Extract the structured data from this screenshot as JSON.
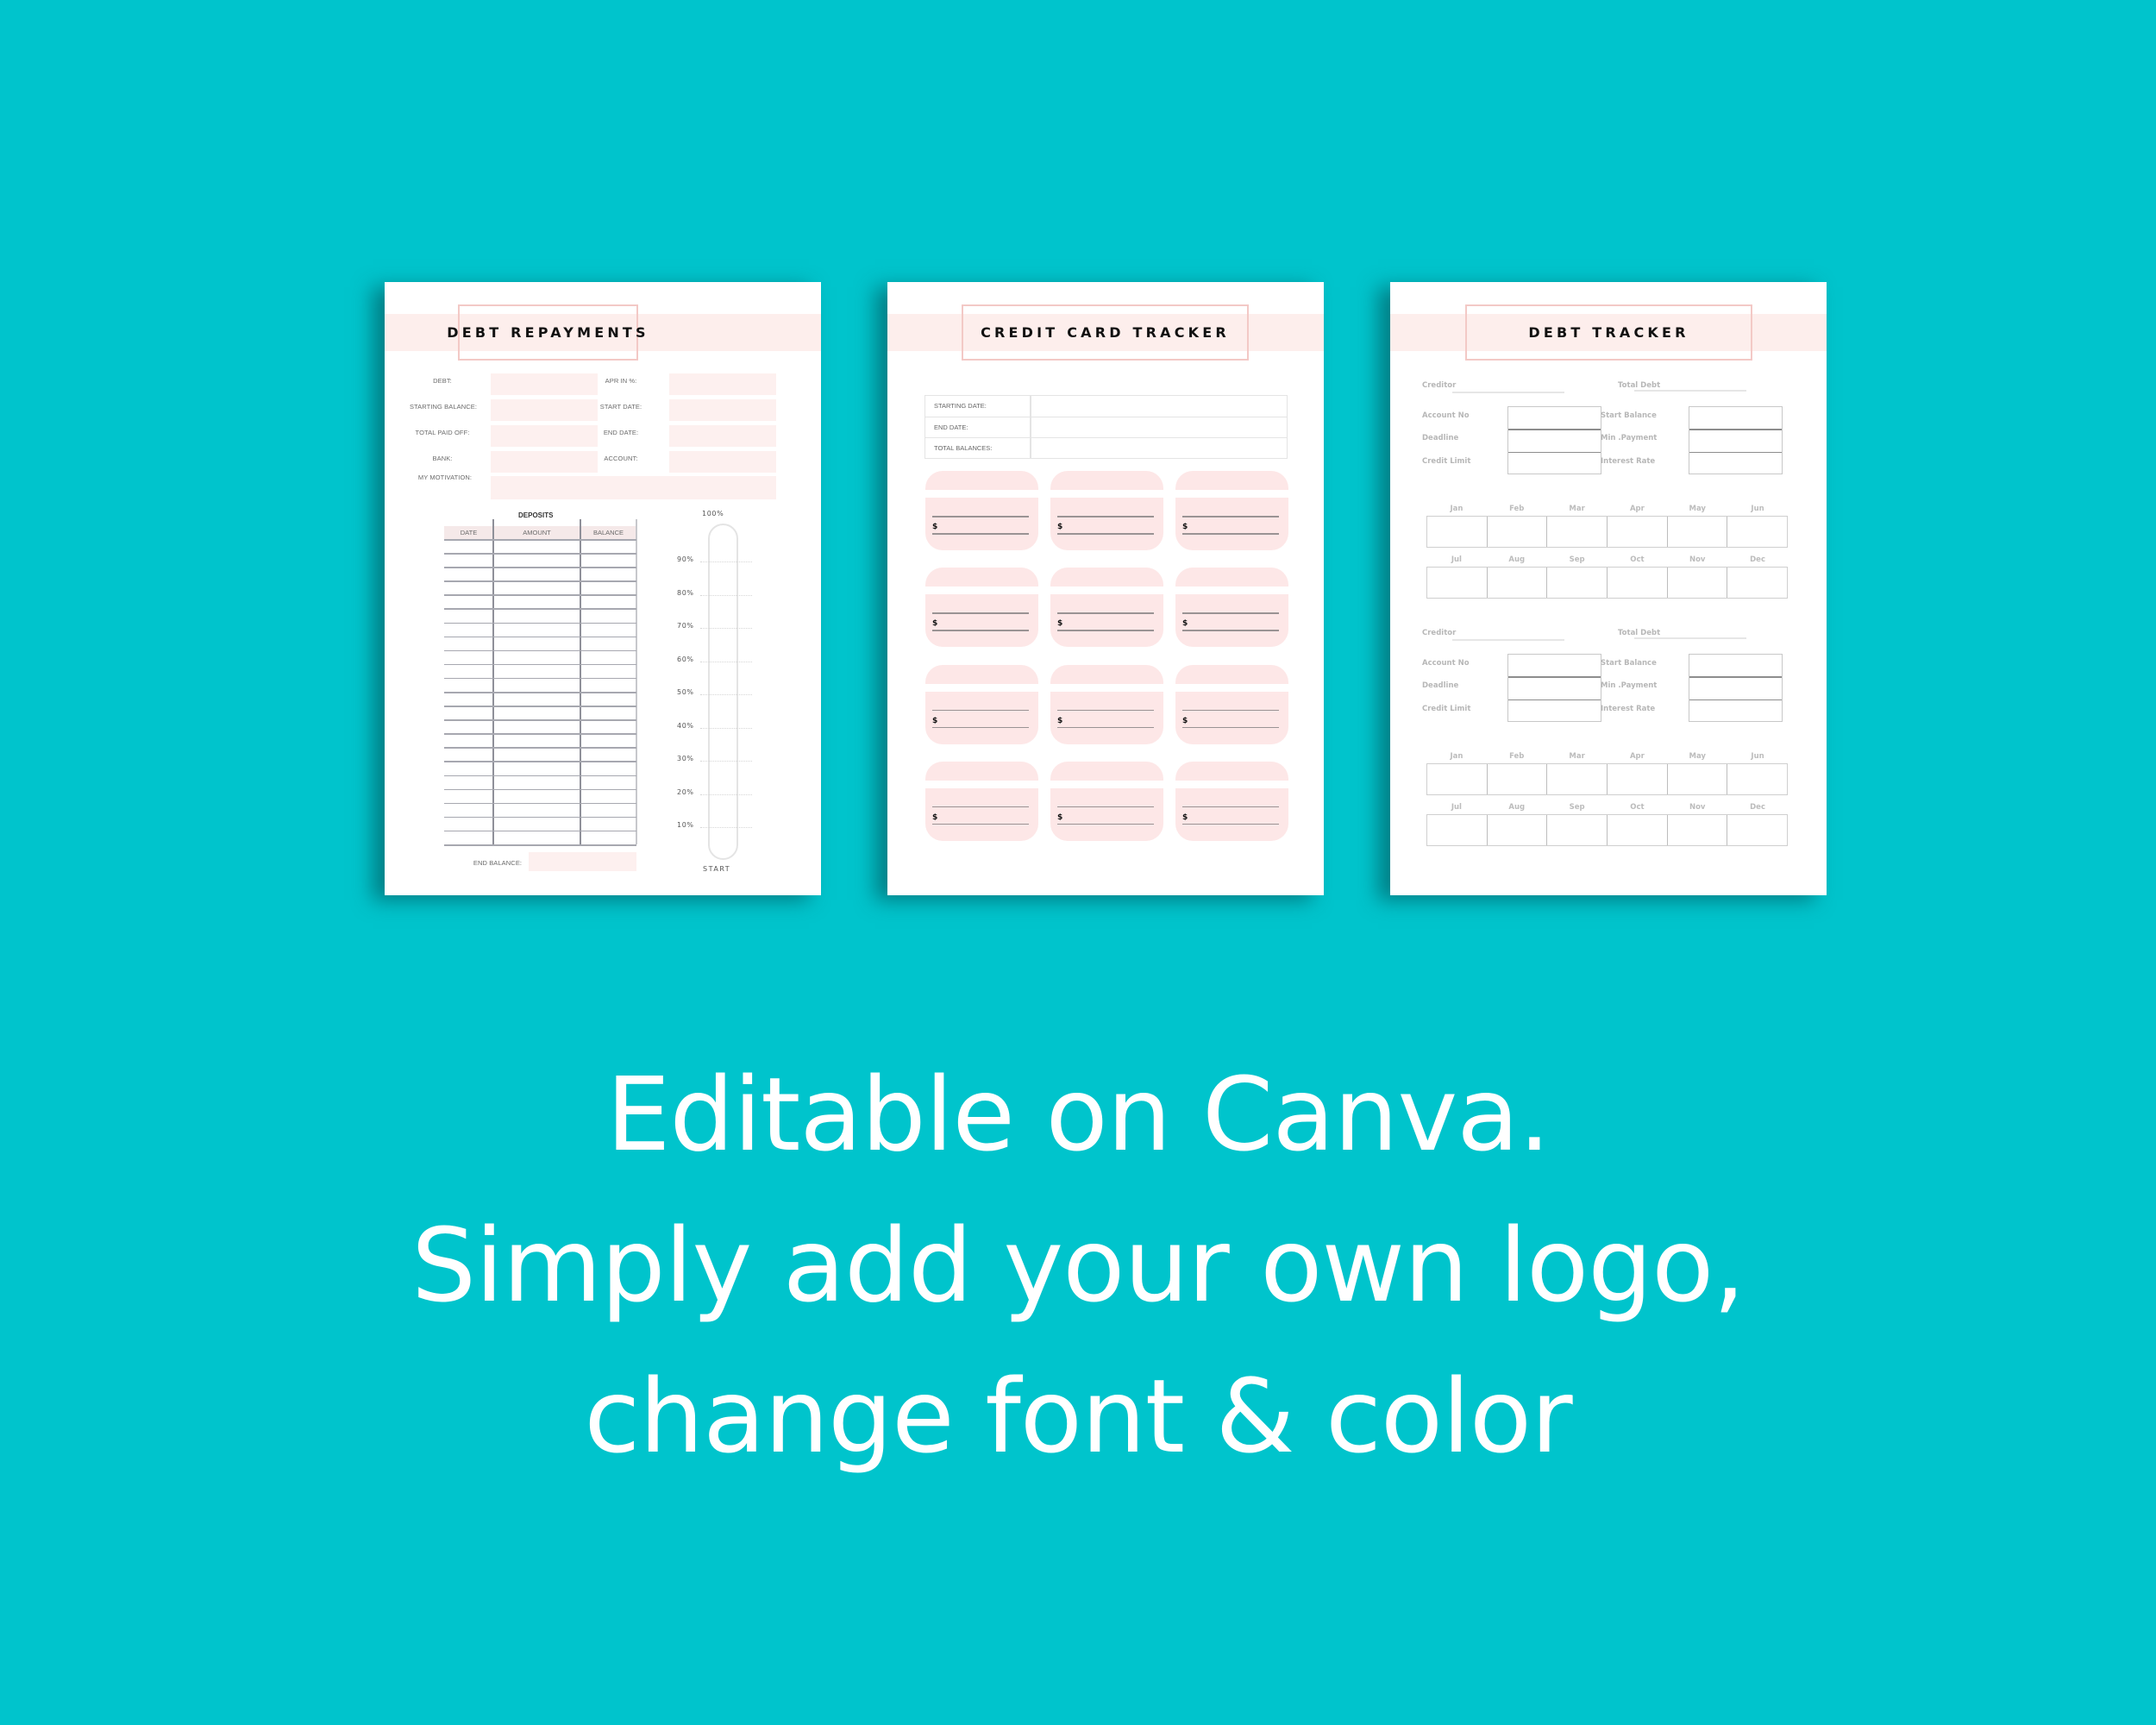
{
  "colors": {
    "background": "#00c4cc",
    "accent_pink": "#fdeeec",
    "title_border": "#f3c9c6",
    "card_pink": "#fde7e7"
  },
  "pages": [
    {
      "title": "DEBT REPAYMENTS",
      "fields": [
        {
          "label": "DEBT:",
          "value": ""
        },
        {
          "label": "APR IN %:",
          "value": ""
        },
        {
          "label": "STARTING BALANCE:",
          "value": ""
        },
        {
          "label": "START DATE:",
          "value": ""
        },
        {
          "label": "TOTAL PAID OFF:",
          "value": ""
        },
        {
          "label": "END DATE:",
          "value": ""
        },
        {
          "label": "BANK:",
          "value": ""
        },
        {
          "label": "ACCOUNT:",
          "value": ""
        },
        {
          "label": "MY MOTIVATION:",
          "value": ""
        }
      ],
      "deposits": {
        "title": "DEPOSITS",
        "columns": [
          "DATE",
          "AMOUNT",
          "BALANCE"
        ],
        "row_count": 22,
        "end_balance_label": "END BALANCE:",
        "end_balance_value": ""
      },
      "progress": {
        "top_label": "100%",
        "bottom_label": "START",
        "ticks": [
          "90%",
          "80%",
          "70%",
          "60%",
          "50%",
          "40%",
          "30%",
          "20%",
          "10%"
        ],
        "fill_percent": 0
      }
    },
    {
      "title": "CREDIT CARD TRACKER",
      "summary_rows": [
        {
          "label": "STARTING DATE:",
          "value": ""
        },
        {
          "label": "END DATE:",
          "value": ""
        },
        {
          "label": "TOTAL BALANCES:",
          "value": ""
        }
      ],
      "card_currency_symbol": "$",
      "card_count": 12
    },
    {
      "title": "DEBT TRACKER",
      "sections": [
        {
          "creditor_label": "Creditor",
          "total_debt_label": "Total Debt",
          "left_fields": [
            "Account No",
            "Deadline",
            "Credit Limit"
          ],
          "right_fields": [
            "Start Balance",
            "Min .Payment",
            "Interest Rate"
          ],
          "months_row1": [
            "Jan",
            "Feb",
            "Mar",
            "Apr",
            "May",
            "Jun"
          ],
          "months_row2": [
            "Jul",
            "Aug",
            "Sep",
            "Oct",
            "Nov",
            "Dec"
          ]
        },
        {
          "creditor_label": "Creditor",
          "total_debt_label": "Total Debt",
          "left_fields": [
            "Account No",
            "Deadline",
            "Credit Limit"
          ],
          "right_fields": [
            "Start Balance",
            "Min .Payment",
            "Interest Rate"
          ],
          "months_row1": [
            "Jan",
            "Feb",
            "Mar",
            "Apr",
            "May",
            "Jun"
          ],
          "months_row2": [
            "Jul",
            "Aug",
            "Sep",
            "Oct",
            "Nov",
            "Dec"
          ]
        }
      ]
    }
  ],
  "caption": {
    "line1": "Editable on Canva.",
    "line2": "Simply add your own logo,",
    "line3": "change font & color"
  }
}
